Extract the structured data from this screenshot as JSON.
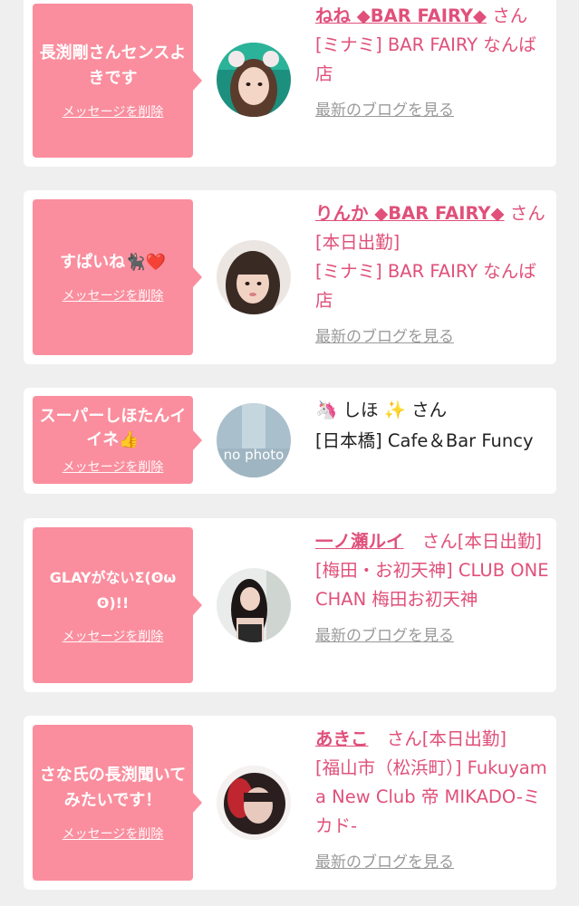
{
  "cards": [
    {
      "message": "長渕剛さんセンスよきです",
      "delete_label": "メッセージを削除",
      "name": "ねね ◆BAR FAIRY◆",
      "san": "さん",
      "shop": "[ミナミ] BAR FAIRY なんば店",
      "blog_label": "最新のブログを見る"
    },
    {
      "message": "すぱいね🐈‍⬛❤️",
      "delete_label": "メッセージを削除",
      "name": "りんか ◆BAR FAIRY◆",
      "san": "さん[本日出勤]",
      "shop": "[ミナミ] BAR FAIRY なんば店",
      "blog_label": "最新のブログを見る"
    },
    {
      "message": "スーパーしほたんイイネ👍",
      "delete_label": "メッセージを削除",
      "name": "🦄 しほ ✨",
      "san": "さん",
      "shop": "[日本橋] Cafe＆Bar Funcy",
      "avatar_text": "no photo"
    },
    {
      "message": "GLAYがないΣ(ʘωʘ)!!",
      "delete_label": "メッセージを削除",
      "name": "一ノ瀬ルイ",
      "san": "さん[本日出勤]",
      "shop": "[梅田・お初天神] CLUB ONE CHAN 梅田お初天神",
      "blog_label": "最新のブログを見る"
    },
    {
      "message": "さな氏の長渕聞いてみたいです！",
      "delete_label": "メッセージを削除",
      "name": "あきこ",
      "san": "さん[本日出勤]",
      "shop": "[福山市（松浜町）] Fukuyama New Club 帝 MIKADO-ミカド-",
      "blog_label": "最新のブログを見る"
    }
  ],
  "colors": {
    "bubble": "#fa8e9e",
    "accent_text": "#e0507a",
    "link_gray": "#9a9a9a",
    "background": "#efefef"
  }
}
